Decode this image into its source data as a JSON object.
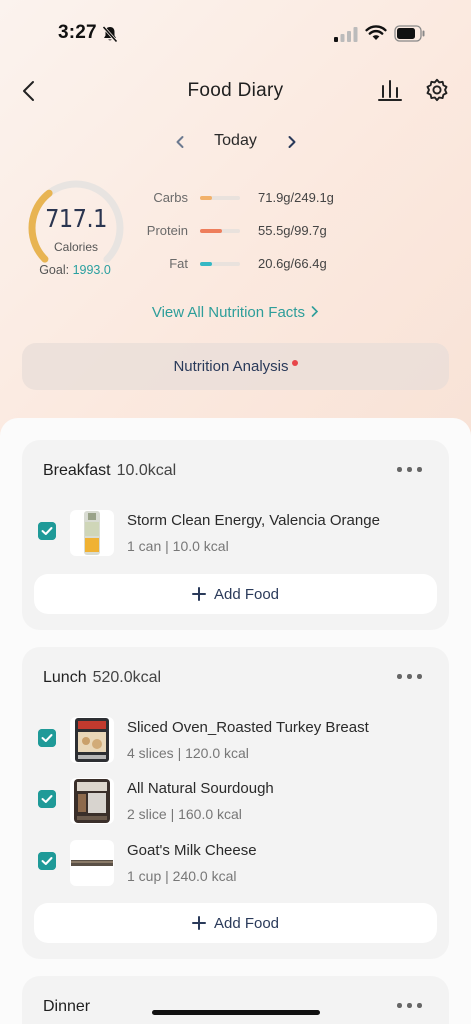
{
  "status_bar": {
    "time": "3:27"
  },
  "header": {
    "title": "Food Diary"
  },
  "date_nav": {
    "label": "Today"
  },
  "summary": {
    "calories_value": "717.1",
    "calories_unit": "Calories",
    "goal_label": "Goal:",
    "goal_value": "1993.0",
    "calories_progress": 0.36,
    "macros": [
      {
        "label": "Carbs",
        "value": "71.9g/249.1g",
        "progress": 0.29,
        "color": "#f2b16a"
      },
      {
        "label": "Protein",
        "value": "55.5g/99.7g",
        "progress": 0.56,
        "color": "#ee7e5c"
      },
      {
        "label": "Fat",
        "value": "20.6g/66.4g",
        "progress": 0.31,
        "color": "#35b8c4"
      }
    ],
    "accent_color": "#e8b452"
  },
  "links": {
    "view_all": "View All Nutrition Facts",
    "analysis": "Nutrition Analysis"
  },
  "meals": [
    {
      "name": "Breakfast",
      "kcal": "10.0kcal",
      "add_label": "Add Food",
      "items": [
        {
          "name": "Storm Clean Energy, Valencia Orange",
          "detail": "1 can | 10.0 kcal",
          "thumb": "can"
        }
      ]
    },
    {
      "name": "Lunch",
      "kcal": "520.0kcal",
      "add_label": "Add Food",
      "items": [
        {
          "name": "Sliced Oven_Roasted Turkey Breast",
          "detail": "4 slices | 120.0 kcal",
          "thumb": "package"
        },
        {
          "name": "All Natural Sourdough",
          "detail": "2 slice | 160.0 kcal",
          "thumb": "bread"
        },
        {
          "name": "Goat's Milk Cheese",
          "detail": "1 cup | 240.0 kcal",
          "thumb": "cheese"
        }
      ]
    },
    {
      "name": "Dinner",
      "kcal": "",
      "items": []
    }
  ],
  "colors": {
    "teal": "#1f9a98",
    "link": "#2e9e9a"
  }
}
